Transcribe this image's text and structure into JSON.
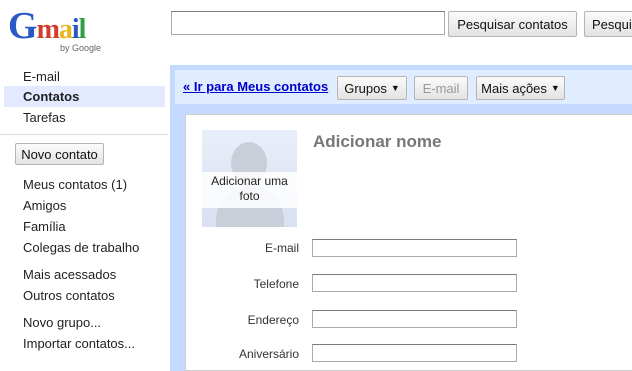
{
  "brand": {
    "logo_letters": [
      "G",
      "m",
      "a",
      "i",
      "l"
    ],
    "logo_colors": [
      "#2a58c5",
      "#d13c2c",
      "#e6b51f",
      "#2a58c5",
      "#2e9d46"
    ],
    "byline": "by Google"
  },
  "search": {
    "query": "",
    "contacts_button": "Pesquisar contatos",
    "web_button": "Pesquisar a Web"
  },
  "nav": {
    "email": "E-mail",
    "contacts": "Contatos",
    "tasks": "Tarefas",
    "new_contact": "Novo contato",
    "groups": [
      "Meus contatos (1)",
      "Amigos",
      "Família",
      "Colegas de trabalho"
    ],
    "most_contacted": "Mais acessados",
    "other_contacts": "Outros contatos",
    "new_group": "Novo grupo...",
    "import_contacts": "Importar contatos..."
  },
  "toolbar": {
    "back_link": "« Ir para Meus contatos",
    "groups_button": "Grupos",
    "email_button": "E-mail",
    "more_actions_button": "Mais ações",
    "dropdown_arrow": "▼"
  },
  "contact": {
    "add_photo": "Adicionar uma foto",
    "add_name": "Adicionar nome",
    "fields": {
      "email_label": "E-mail",
      "email_value": "",
      "phone_label": "Telefone",
      "phone_value": "",
      "address_label": "Endereço",
      "address_value": "",
      "birthday_label": "Aniversário",
      "birthday_value": ""
    }
  },
  "colors": {
    "accent_blue": "#c3d9ff",
    "toolbar_blue": "#e0ecff",
    "link": "#0000cc",
    "selected_nav": "#e3e9ff"
  }
}
